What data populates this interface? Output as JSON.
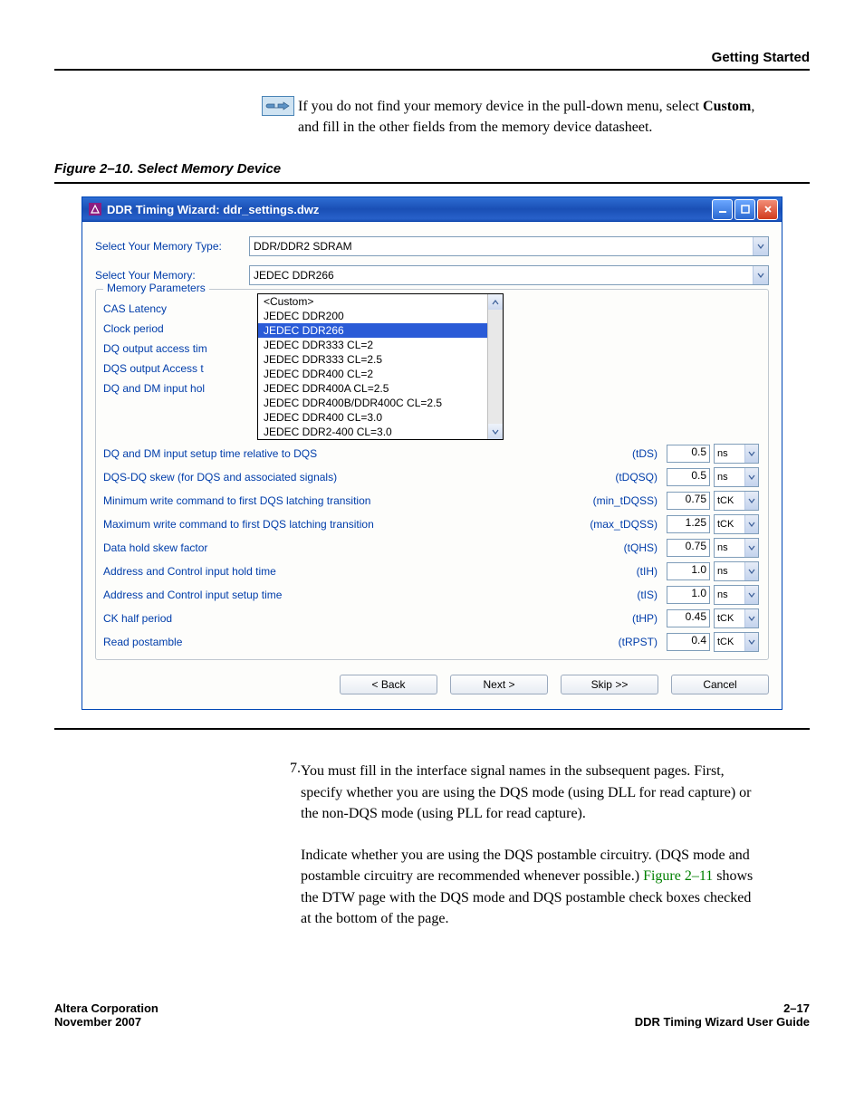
{
  "header": {
    "section": "Getting Started"
  },
  "note": {
    "text_1": "If you do not find your memory device in the pull-down menu, select ",
    "bold": "Custom",
    "text_2": ", and fill in the other fields from the memory device datasheet."
  },
  "figure": {
    "caption": "Figure 2–10. Select Memory Device"
  },
  "dialog": {
    "title": "DDR Timing Wizard: ddr_settings.dwz",
    "memtype_label": "Select Your Memory Type:",
    "memtype_value": "DDR/DDR2 SDRAM",
    "mem_label": "Select Your Memory:",
    "mem_value": "JEDEC DDR266",
    "group_label": "Memory Parameters",
    "left_labels": [
      "CAS Latency",
      "Clock period",
      "DQ output access tim",
      "DQS output Access t",
      "DQ and DM input hol"
    ],
    "dd_items": [
      "<Custom>",
      "JEDEC DDR200",
      "JEDEC DDR266",
      "JEDEC DDR333 CL=2",
      "JEDEC DDR333 CL=2.5",
      "JEDEC DDR400 CL=2",
      "JEDEC DDR400A CL=2.5",
      "JEDEC DDR400B/DDR400C CL=2.5",
      "JEDEC DDR400 CL=3.0",
      "JEDEC DDR2-400 CL=3.0"
    ],
    "dd_selected_index": 2,
    "params": [
      {
        "name": "DQ and DM input setup time relative to DQS",
        "code": "(tDS)",
        "value": "0.5",
        "unit": "ns"
      },
      {
        "name": "DQS-DQ skew (for DQS and associated signals)",
        "code": "(tDQSQ)",
        "value": "0.5",
        "unit": "ns"
      },
      {
        "name": "Minimum write command to first DQS latching transition",
        "code": "(min_tDQSS)",
        "value": "0.75",
        "unit": "tCK"
      },
      {
        "name": "Maximum write command to first DQS latching transition",
        "code": "(max_tDQSS)",
        "value": "1.25",
        "unit": "tCK"
      },
      {
        "name": "Data hold skew factor",
        "code": "(tQHS)",
        "value": "0.75",
        "unit": "ns"
      },
      {
        "name": "Address and Control input hold time",
        "code": "(tIH)",
        "value": "1.0",
        "unit": "ns"
      },
      {
        "name": "Address and Control input setup time",
        "code": "(tIS)",
        "value": "1.0",
        "unit": "ns"
      },
      {
        "name": "CK half period",
        "code": "(tHP)",
        "value": "0.45",
        "unit": "tCK"
      },
      {
        "name": "Read postamble",
        "code": "(tRPST)",
        "value": "0.4",
        "unit": "tCK"
      }
    ],
    "buttons": {
      "back": "< Back",
      "next": "Next >",
      "skip": "Skip >>",
      "cancel": "Cancel"
    }
  },
  "step": {
    "num": "7.",
    "para1_a": "You must fill in the interface signal names in the subsequent pages. First, specify whether you are using the DQS mode (using DLL for read capture) or the non-DQS mode (using PLL for read capture).",
    "para2_a": "Indicate whether you are using the DQS postamble circuitry. (DQS mode and postamble circuitry are recommended whenever possible.) ",
    "link": "Figure 2–11",
    "para2_b": " shows the DTW page with the DQS mode and DQS postamble check boxes checked at the bottom of the page."
  },
  "footer": {
    "l1": "Altera Corporation",
    "l2": "November 2007",
    "r1": "2–17",
    "r2": "DDR Timing Wizard User Guide"
  }
}
